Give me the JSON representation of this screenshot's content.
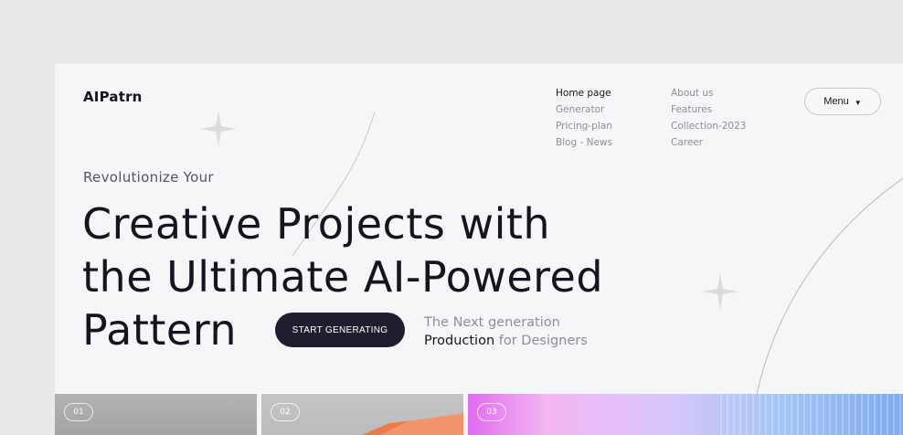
{
  "brand": {
    "logo": "AIPatrn"
  },
  "nav": {
    "col1": [
      "Home page",
      "Generator",
      "Pricing-plan",
      "Blog - News"
    ],
    "col2": [
      "About us",
      "Features",
      "Collection-2023",
      "Career"
    ]
  },
  "menu": {
    "label": "Menu",
    "icon": "caret-down-icon"
  },
  "hero": {
    "subtitle": "Revolutionize Your",
    "line1": "Creative Projects with",
    "line2": "the Ultimate AI-Powered",
    "line3": "Pattern",
    "cta": "START GENERATING",
    "tagline_line1": "The Next generation",
    "tagline_strong": "Production",
    "tagline_rest": " for Designers"
  },
  "tiles": [
    "01",
    "02",
    "03"
  ],
  "colors": {
    "accent": "#1f1d2e",
    "background": "#f5f6f7",
    "muted": "#8e8e96"
  }
}
